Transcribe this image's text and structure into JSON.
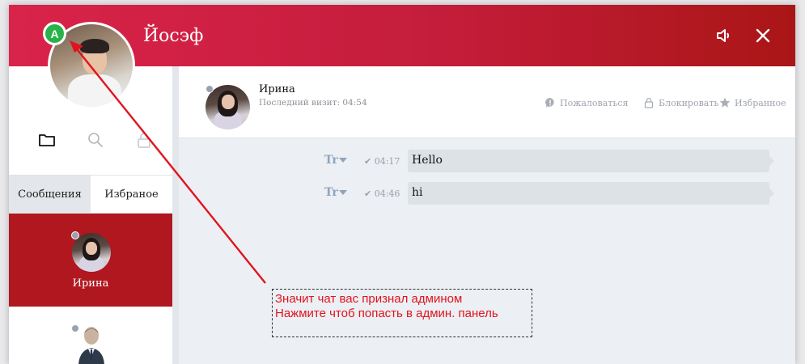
{
  "header": {
    "title": "Йосэф",
    "badge_letter": "A",
    "icons": [
      "volume-icon",
      "close-icon"
    ]
  },
  "sidebar": {
    "icons": [
      "folder-icon",
      "search-icon",
      "lock-icon"
    ],
    "tabs": [
      {
        "label": "Сообщения",
        "active": true
      },
      {
        "label": "Избраное",
        "active": false
      }
    ],
    "contacts": [
      {
        "name": "Ирина",
        "selected": true
      },
      {
        "name": "",
        "selected": false
      }
    ]
  },
  "chat_header": {
    "peer_name": "Ирина",
    "last_visit": "Последний визит: 04:54",
    "actions": {
      "report": "Пожаловаться",
      "block": "Блокировать",
      "favorite": "Избранное"
    }
  },
  "messages": [
    {
      "translate_label": "Tr",
      "check": "✔",
      "time": "04:17",
      "text": "Hello"
    },
    {
      "translate_label": "Tr",
      "check": "✔",
      "time": "04:46",
      "text": "hi"
    }
  ],
  "annotation": {
    "line1": "Значит чат вас признал админом",
    "line2": "Нажмите чтоб попасть в админ. панель"
  },
  "colors": {
    "header_start": "#d9234a",
    "header_end": "#aa1616",
    "selected_contact": "#b0171f",
    "admin_badge": "#2ab24a",
    "annotation": "#e0141e"
  }
}
